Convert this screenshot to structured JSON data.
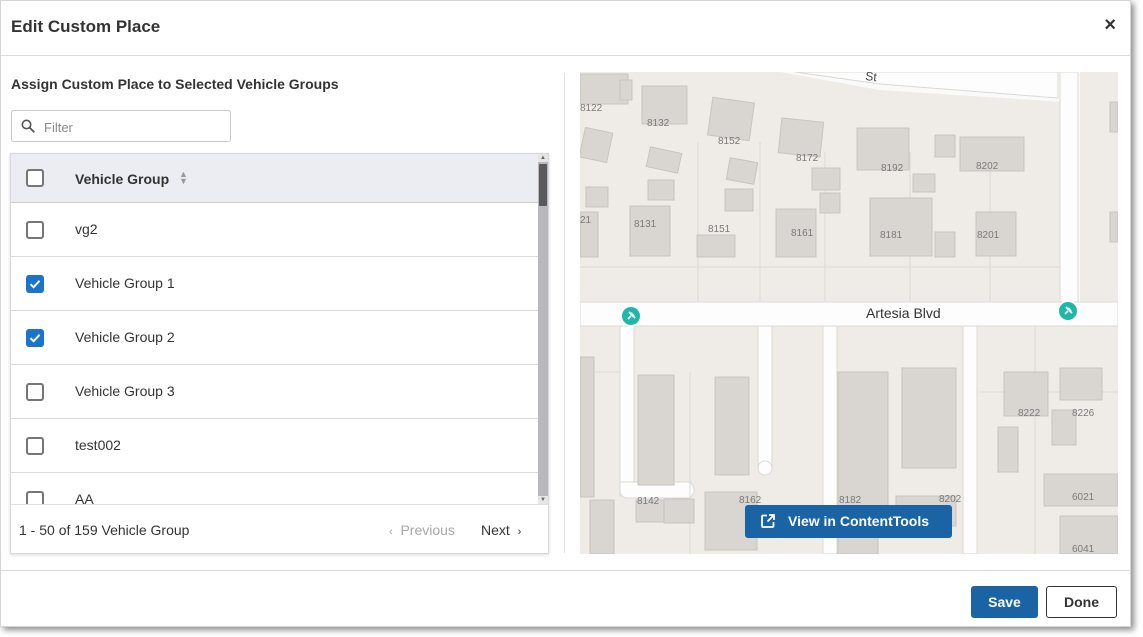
{
  "dialog": {
    "title": "Edit Custom Place",
    "close_label": "×"
  },
  "assign": {
    "subtitle": "Assign Custom Place to Selected Vehicle Groups",
    "filter_placeholder": "Filter"
  },
  "table": {
    "column_header": "Vehicle Group",
    "header_checked": false,
    "rows": [
      {
        "label": "vg2",
        "checked": false
      },
      {
        "label": "Vehicle Group 1",
        "checked": true
      },
      {
        "label": "Vehicle Group 2",
        "checked": true
      },
      {
        "label": "Vehicle Group 3",
        "checked": false
      },
      {
        "label": "test002",
        "checked": false
      },
      {
        "label": "AA",
        "checked": false
      }
    ],
    "pagination": {
      "count_text": "1 - 50 of 159 Vehicle Group",
      "previous_label": "Previous",
      "next_label": "Next"
    }
  },
  "map": {
    "street_main": "Artesia Blvd",
    "street_top": "St",
    "house_numbers": [
      "8122",
      "8132",
      "8152",
      "8172",
      "8192",
      "8202",
      "8131",
      "8151",
      "8161",
      "8181",
      "8201",
      "21",
      "8222",
      "8226",
      "8142",
      "8162",
      "8182",
      "8202",
      "6021",
      "6041"
    ],
    "view_button_label": "View in ContentTools",
    "pin_color": "#1fb8a8"
  },
  "footer": {
    "save_label": "Save",
    "done_label": "Done"
  },
  "colors": {
    "accent": "#1a64a6",
    "checkbox_checked": "#1b74c9"
  }
}
